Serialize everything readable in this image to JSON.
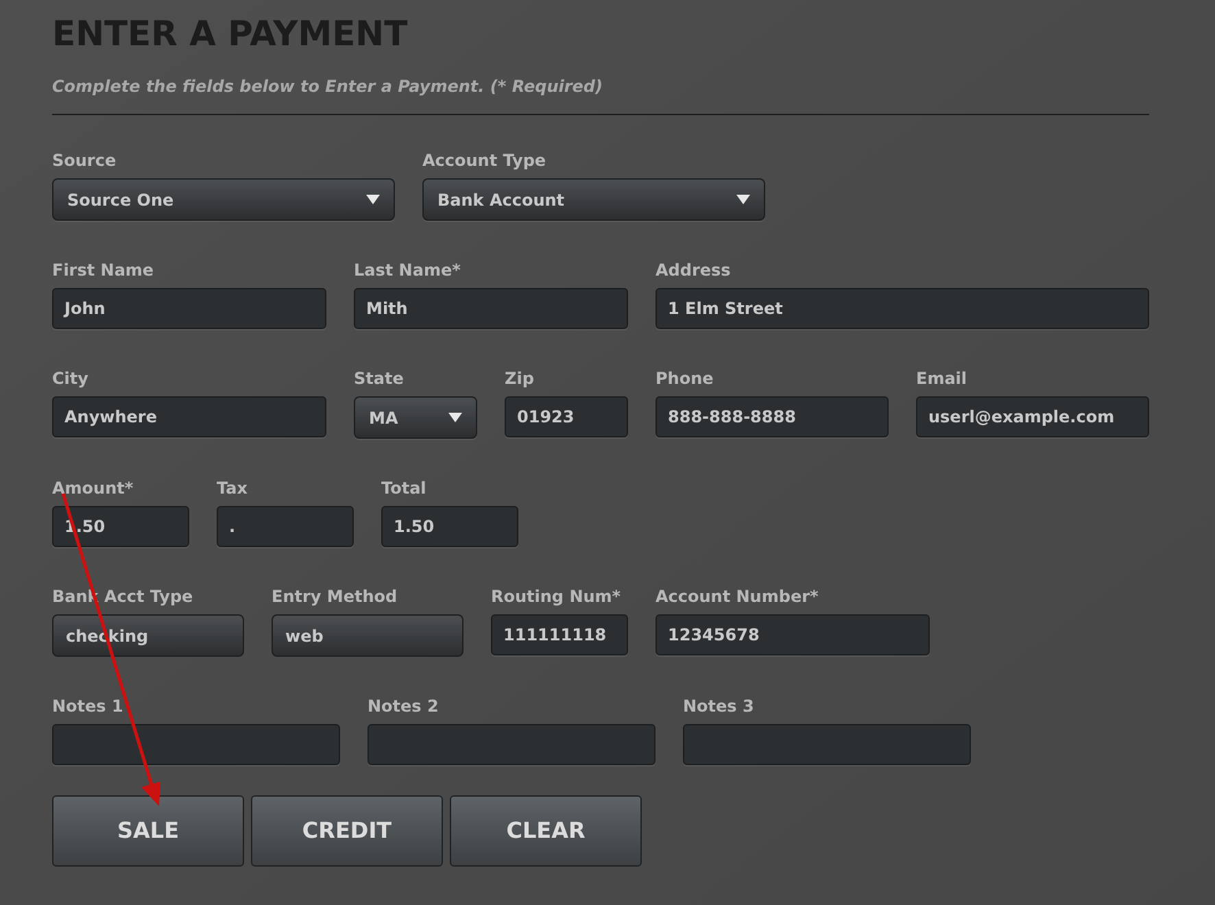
{
  "title": "ENTER A PAYMENT",
  "subtitle": "Complete the fields below to Enter a Payment. (* Required)",
  "rows": [
    {
      "fields": [
        {
          "label": "Source",
          "kind": "select",
          "value": "Source One"
        },
        {
          "label": "Account Type",
          "kind": "select",
          "value": "Bank Account"
        }
      ]
    },
    {
      "fields": [
        {
          "label": "First Name",
          "kind": "input",
          "value": "John"
        },
        {
          "label": "Last Name*",
          "kind": "input",
          "value": "Mith"
        },
        {
          "label": "Address",
          "kind": "input",
          "value": "1 Elm Street"
        }
      ]
    },
    {
      "fields": [
        {
          "label": "City",
          "kind": "input",
          "value": "Anywhere"
        },
        {
          "label": "State",
          "kind": "select",
          "value": "MA"
        },
        {
          "label": "Zip",
          "kind": "input",
          "value": "01923"
        },
        {
          "label": "Phone",
          "kind": "input",
          "value": "888-888-8888"
        },
        {
          "label": "Email",
          "kind": "input",
          "value": "userl@example.com"
        }
      ]
    },
    {
      "fields": [
        {
          "label": "Amount*",
          "kind": "input",
          "value": "1.50"
        },
        {
          "label": "Tax",
          "kind": "input",
          "value": "."
        },
        {
          "label": "Total",
          "kind": "input",
          "value": "1.50"
        }
      ]
    },
    {
      "fields": [
        {
          "label": "Bank Acct Type",
          "kind": "readonly",
          "value": "checking"
        },
        {
          "label": "Entry Method",
          "kind": "readonly",
          "value": "web"
        },
        {
          "label": "Routing Num*",
          "kind": "input",
          "value": "111111118"
        },
        {
          "label": "Account Number*",
          "kind": "input",
          "value": "12345678"
        }
      ]
    },
    {
      "fields": [
        {
          "label": "Notes 1",
          "kind": "input"
        },
        {
          "label": "Notes 2",
          "kind": "input"
        },
        {
          "label": "Notes 3",
          "kind": "input"
        }
      ]
    }
  ],
  "buttons": [
    "SALE",
    "CREDIT",
    "CLEAR"
  ]
}
